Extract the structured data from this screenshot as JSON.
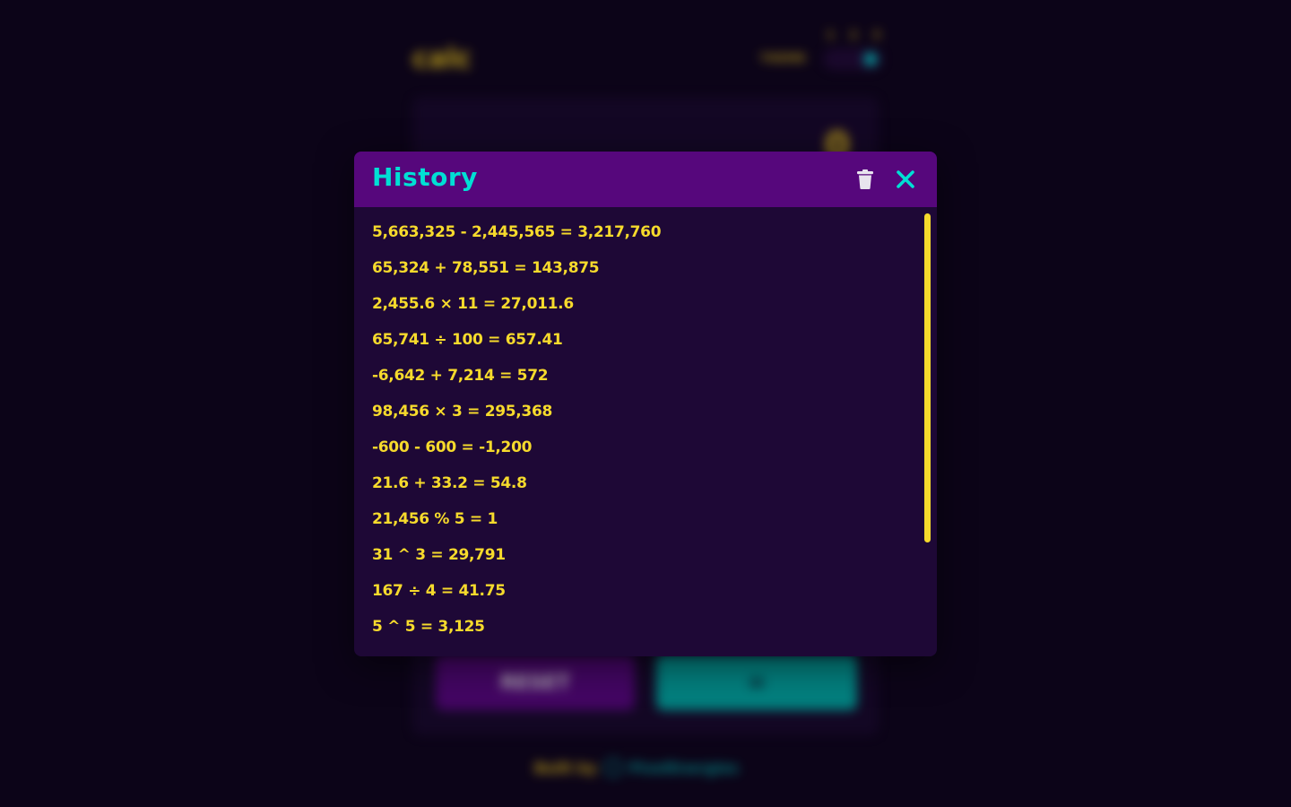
{
  "background": {
    "logo": "calc",
    "theme_label": "THEME",
    "theme_options": [
      "1",
      "2",
      "3"
    ],
    "display_value": "0",
    "reset_label": "RESET",
    "equals_label": "=",
    "footer_built_by": "Built by",
    "footer_author": "PixelEnergies"
  },
  "modal": {
    "title": "History",
    "trash_icon": "trash-icon",
    "close_icon": "close-icon",
    "items": [
      "5,663,325 - 2,445,565 = 3,217,760",
      "65,324 + 78,551 = 143,875",
      "2,455.6 × 11 = 27,011.6",
      "65,741 ÷ 100 = 657.41",
      "-6,642 + 7,214 = 572",
      "98,456 × 3 = 295,368",
      "-600 - 600 = -1,200",
      "21.6 + 33.2 = 54.8",
      "21,456 % 5 = 1",
      "31 ^ 3 = 29,791",
      "167 ÷ 4 = 41.75",
      "5 ^ 5 = 3,125"
    ]
  },
  "colors": {
    "page_bg": "#0c0418",
    "modal_bg": "#1e0836",
    "header_bg": "#56077c",
    "accent_cyan": "#00dfd4",
    "text_yellow": "#f6da2c",
    "icon_light": "#e8e4ee"
  }
}
